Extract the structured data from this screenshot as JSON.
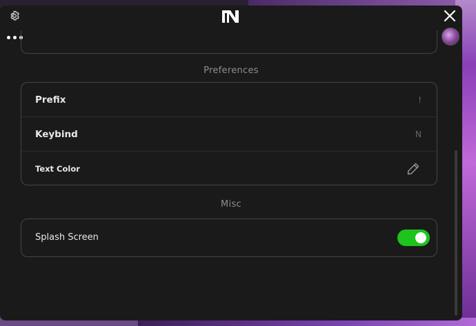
{
  "header": {
    "settings_icon": "gear-icon",
    "logo_icon": "brand-logo",
    "close_icon": "close-icon",
    "menu_icon": "more-dots-icon",
    "avatar": "user-avatar"
  },
  "sections": {
    "preferences": {
      "title": "Preferences",
      "rows": [
        {
          "label": "Prefix",
          "value": "!"
        },
        {
          "label": "Keybind",
          "value": "N"
        },
        {
          "label": "Text Color",
          "icon": "pencil-icon"
        }
      ]
    },
    "misc": {
      "title": "Misc",
      "rows": [
        {
          "label": "Splash Screen",
          "toggle_on": true
        }
      ]
    }
  },
  "colors": {
    "panel_bg": "#1a1a1a",
    "toggle_on": "#1ec31e",
    "border": "#454545"
  }
}
